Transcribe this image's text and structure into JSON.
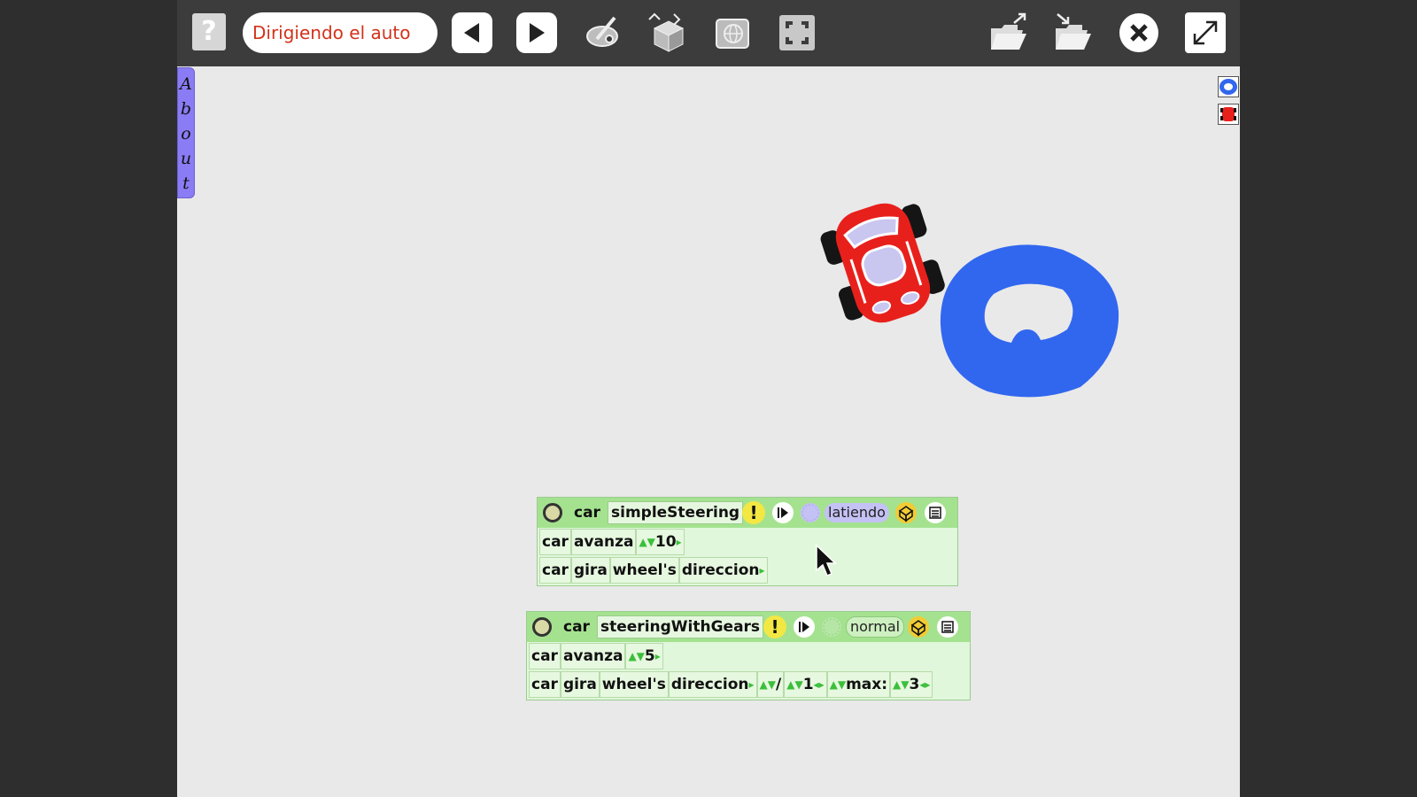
{
  "toolbar": {
    "help_label": "?",
    "project_title": "Dirigiendo el auto"
  },
  "about_tab": {
    "letters": [
      "A",
      "b",
      "o",
      "u",
      "t"
    ]
  },
  "colors": {
    "toolbar_bg": "#3c3c3c",
    "stage_bg": "#e9e9e9",
    "script_header": "#a4e28f",
    "script_body": "#e0f7db",
    "title_text": "#d3321b",
    "about_tab": "#8a7cf4",
    "pond": "#3167ef",
    "car": "#e8201c"
  },
  "script1": {
    "object": "car",
    "name": "simpleSteering",
    "bang": "!",
    "status": "latiendo",
    "row1": {
      "obj": "car",
      "cmd": "avanza",
      "value": "10"
    },
    "row2": {
      "obj": "car",
      "cmd": "gira",
      "owner": "wheel's",
      "attr": "direccion"
    }
  },
  "script2": {
    "object": "car",
    "name": "steeringWithGears",
    "bang": "!",
    "status": "normal",
    "row1": {
      "obj": "car",
      "cmd": "avanza",
      "value": "5"
    },
    "row2": {
      "obj": "car",
      "cmd": "gira",
      "owner": "wheel's",
      "attr": "direccion",
      "op": "/",
      "divisor": "1",
      "max_label": "max:",
      "max_value": "3"
    }
  }
}
